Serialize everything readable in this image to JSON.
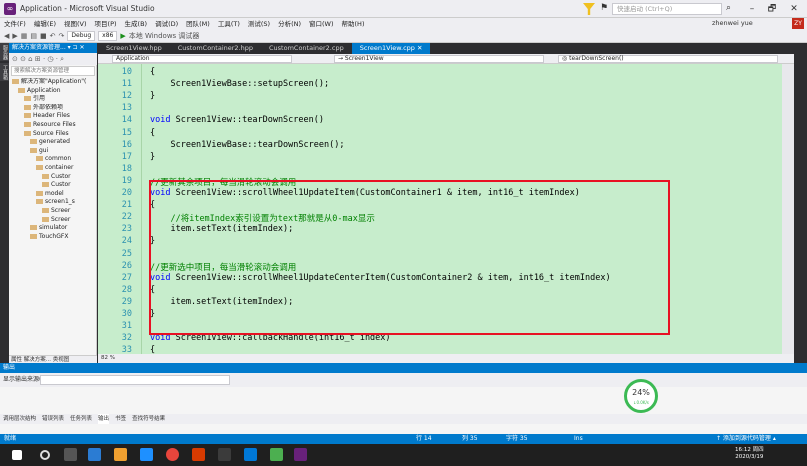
{
  "window": {
    "title": "Application - Microsoft Visual Studio",
    "quick_launch_placeholder": "快速启动 (Ctrl+Q)",
    "user": "zhenwei yue",
    "user_badge": "ZY",
    "minimize": "–",
    "maximize": "🗗",
    "close": "✕"
  },
  "menu": [
    "文件(F)",
    "编辑(E)",
    "视图(V)",
    "项目(P)",
    "生成(B)",
    "调试(D)",
    "团队(M)",
    "工具(T)",
    "测试(S)",
    "分析(N)",
    "窗口(W)",
    "帮助(H)"
  ],
  "toolbar": {
    "config": "Debug",
    "platform": "x86",
    "run_label": "本地 Windows 调试器"
  },
  "solution": {
    "title": "解决方案资源管理... ▾ ⊐ ✕",
    "search_placeholder": "搜索解决方案资源管理",
    "tree": [
      {
        "label": "解决方案\"Application\"(",
        "indent": 0
      },
      {
        "label": "Application",
        "indent": 1
      },
      {
        "label": "引用",
        "indent": 2
      },
      {
        "label": "外部依赖项",
        "indent": 2
      },
      {
        "label": "Header Files",
        "indent": 2
      },
      {
        "label": "Resource Files",
        "indent": 2
      },
      {
        "label": "Source Files",
        "indent": 2
      },
      {
        "label": "generated",
        "indent": 3
      },
      {
        "label": "gui",
        "indent": 3
      },
      {
        "label": "common",
        "indent": 4
      },
      {
        "label": "container",
        "indent": 4
      },
      {
        "label": "Custor",
        "indent": 5
      },
      {
        "label": "Custor",
        "indent": 5
      },
      {
        "label": "model",
        "indent": 4
      },
      {
        "label": "screen1_s",
        "indent": 4
      },
      {
        "label": "Screer",
        "indent": 5
      },
      {
        "label": "Screer",
        "indent": 5
      },
      {
        "label": "simulator",
        "indent": 3
      },
      {
        "label": "TouchGFX",
        "indent": 3
      }
    ],
    "bottom_tabs": "属性  解决方案...  类视图",
    "zoom": "82 %"
  },
  "editor": {
    "tabs": [
      "Screen1View.hpp",
      "CustomContainer2.hpp",
      "CustomContainer2.cpp",
      "Screen1View.cpp ✕"
    ],
    "nav": [
      "Application",
      "→ Screen1View",
      "◎ tearDownScreen()"
    ],
    "lines": [
      {
        "n": "10",
        "t": "{"
      },
      {
        "n": "11",
        "t": "    Screen1ViewBase::setupScreen();"
      },
      {
        "n": "12",
        "t": "}"
      },
      {
        "n": "13",
        "t": ""
      },
      {
        "n": "14",
        "t": "void Screen1View::tearDownScreen()"
      },
      {
        "n": "15",
        "t": "{"
      },
      {
        "n": "16",
        "t": "    Screen1ViewBase::tearDownScreen();"
      },
      {
        "n": "17",
        "t": "}"
      },
      {
        "n": "18",
        "t": ""
      },
      {
        "n": "19",
        "t": "//更新其余项目，每当滑轮滚动会调用"
      },
      {
        "n": "20",
        "t": "void Screen1View::scrollWheel1UpdateItem(CustomContainer1 & item, int16_t itemIndex)"
      },
      {
        "n": "21",
        "t": "{"
      },
      {
        "n": "22",
        "t": "    //将itemIndex索引设置为text那就是从0-max显示"
      },
      {
        "n": "23",
        "t": "    item.setText(itemIndex);"
      },
      {
        "n": "24",
        "t": "}"
      },
      {
        "n": "25",
        "t": ""
      },
      {
        "n": "26",
        "t": "//更新选中项目，每当滑轮滚动会调用"
      },
      {
        "n": "27",
        "t": "void Screen1View::scrollWheel1UpdateCenterItem(CustomContainer2 & item, int16_t itemIndex)"
      },
      {
        "n": "28",
        "t": "{"
      },
      {
        "n": "29",
        "t": "    item.setText(itemIndex);"
      },
      {
        "n": "30",
        "t": "}"
      },
      {
        "n": "31",
        "t": ""
      },
      {
        "n": "32",
        "t": "void Screen1View::callbackHandle(int16_t index)"
      },
      {
        "n": "33",
        "t": "{"
      }
    ],
    "zoom": "82 %"
  },
  "output": {
    "title": "输出",
    "show_from": "显示输出来源(S):",
    "tabs": [
      "调用层次结构",
      "错误列表",
      "任务列表",
      "输出",
      "书签",
      "查找符号结果"
    ],
    "gauge_value": "24%",
    "gauge_sub": "↓0.0K/s"
  },
  "status": {
    "ready": "就绪",
    "line": "行 14",
    "col": "列 35",
    "char": "字符 35",
    "ins": "Ins",
    "add_source": "↑ 添加到源代码管理 ▴"
  },
  "taskbar": {
    "time": "16:12 周四",
    "date": "2020/3/19"
  }
}
